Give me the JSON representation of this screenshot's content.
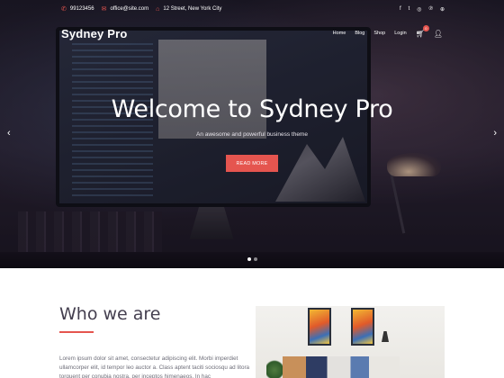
{
  "topbar": {
    "phone": "99123456",
    "email": "office@site.com",
    "address": "12 Street, New York City",
    "icons": {
      "phone": "phone-icon",
      "email": "envelope-icon",
      "address": "home-icon"
    },
    "socials": [
      "facebook-icon",
      "twitter-icon",
      "instagram-icon",
      "pinterest-icon",
      "dribbble-icon"
    ]
  },
  "header": {
    "logo": "Sydney Pro",
    "nav": [
      "Home",
      "Blog",
      "Shop",
      "Login"
    ],
    "cart_count": "0"
  },
  "hero": {
    "title": "Welcome to Sydney Pro",
    "subtitle": "An awesome and powerful business theme",
    "button": "READ MORE",
    "slides": 2,
    "active_slide": 1
  },
  "about": {
    "title": "Who we are",
    "text": "Lorem ipsum dolor sit amet, consectetur adipiscing elit. Morbi imperdiet ullamcorper elit, id tempor leo auctor a. Class aptent taciti sociosqu ad litora torquent per conubia nostra, per inceptos himenaeos. In hac"
  },
  "colors": {
    "accent": "#e5554f",
    "heading": "#443f4f",
    "body_text": "#6d6d78"
  }
}
